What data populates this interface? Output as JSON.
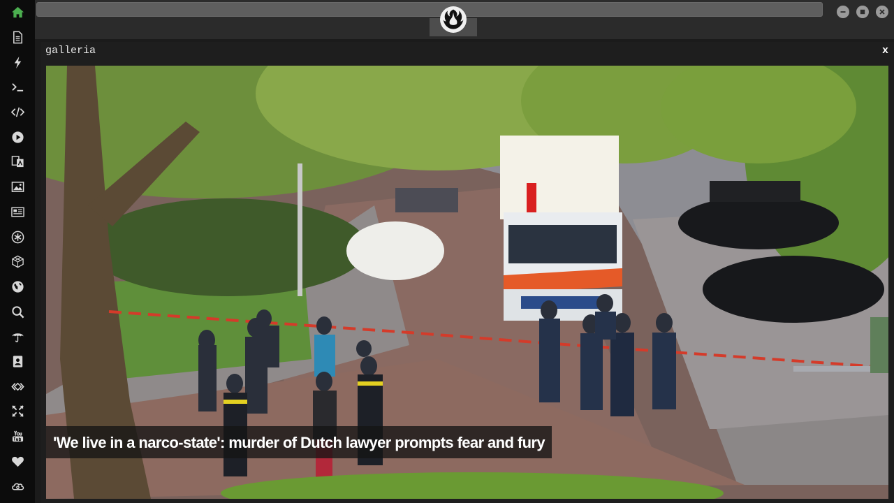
{
  "sidebar": {
    "items": [
      {
        "icon": "home-icon",
        "color": "#4caf50"
      },
      {
        "icon": "document-icon"
      },
      {
        "icon": "lightning-icon"
      },
      {
        "icon": "terminal-icon"
      },
      {
        "icon": "code-icon"
      },
      {
        "icon": "play-icon"
      },
      {
        "icon": "translate-icon"
      },
      {
        "icon": "image-icon"
      },
      {
        "icon": "newspaper-icon"
      },
      {
        "icon": "asterisk-icon"
      },
      {
        "icon": "cube-icon"
      },
      {
        "icon": "globe-icon"
      },
      {
        "icon": "search-icon"
      },
      {
        "icon": "umbrella-icon"
      },
      {
        "icon": "contact-icon"
      },
      {
        "icon": "embed-icon"
      },
      {
        "icon": "expand-icon"
      },
      {
        "icon": "youtube-icon"
      },
      {
        "icon": "heart-icon"
      },
      {
        "icon": "cloud-icon"
      }
    ]
  },
  "topbar": {
    "logo": "rebel-alliance-icon",
    "window_controls": [
      "minimize-icon",
      "maximize-icon",
      "close-icon"
    ]
  },
  "panel": {
    "title": "galleria",
    "close_label": "x"
  },
  "gallery": {
    "caption": "'We live in a narco-state': murder of Dutch lawyer prompts fear and fury"
  },
  "colors": {
    "sidebar_bg": "#0c0c0c",
    "icon": "#d8d8d8",
    "home_icon": "#4caf50",
    "topbar_bg": "#2b2b2b",
    "panel_bg": "#1e1e1e"
  }
}
